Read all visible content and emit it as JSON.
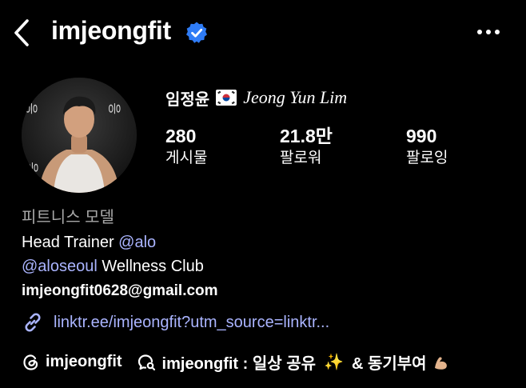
{
  "header": {
    "username": "imjeongfit",
    "verified": true,
    "colors": {
      "verified": "#2f7cf6",
      "link": "#aab4ff",
      "muted": "#a8a8a8"
    }
  },
  "profile": {
    "name_ko": "임정윤",
    "name_flag": "south-korea-flag",
    "name_en": "Jeong Yun Lim",
    "avatar": "profile-photo"
  },
  "stats": [
    {
      "value": "280",
      "label": "게시물"
    },
    {
      "value": "21.8만",
      "label": "팔로워"
    },
    {
      "value": "990",
      "label": "팔로잉"
    }
  ],
  "bio": {
    "category": "피트니스 모델",
    "line1_text": "Head Trainer ",
    "line1_mention": "@alo",
    "line2_mention": "@aloseoul",
    "line2_text": " Wellness Club",
    "email": "imjeongfit0628@gmail.com",
    "link": "linktr.ee/imjeongfit?utm_source=linktr..."
  },
  "threads": {
    "handle": "imjeongfit",
    "feed_label_prefix": "imjeongfit : 일상 공유",
    "feed_sparkle": "✨",
    "feed_label_suffix": "& 동기부여",
    "feed_emoji": "💪🏼"
  }
}
